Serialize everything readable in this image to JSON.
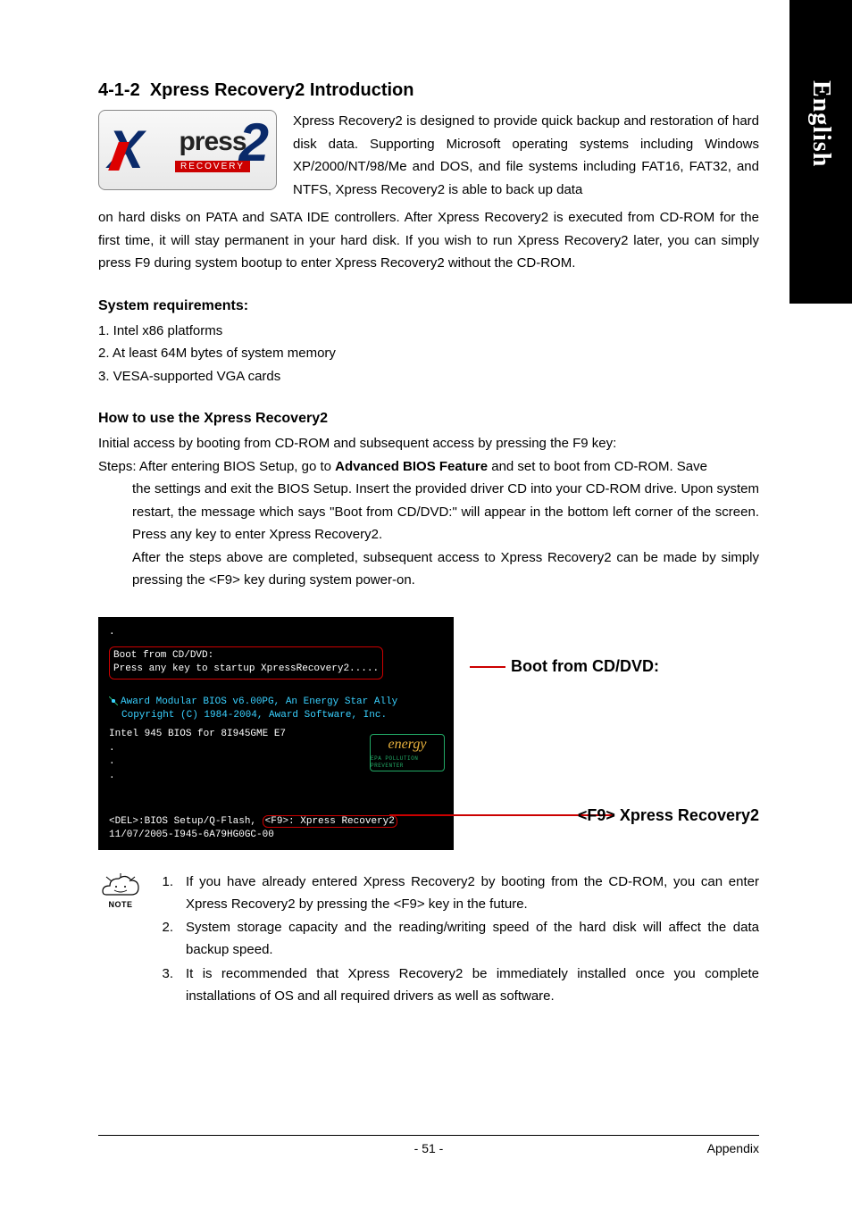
{
  "sidebar": {
    "language": "English"
  },
  "heading": {
    "number": "4-1-2",
    "title": "Xpress Recovery2 Introduction"
  },
  "logo": {
    "press": "press",
    "recovery": "RECOVERY"
  },
  "intro": {
    "right_text": "Xpress Recovery2 is designed to provide quick backup and restoration of hard disk data. Supporting Microsoft operating systems including Windows XP/2000/NT/98/Me and DOS, and file systems including FAT16, FAT32, and NTFS, Xpress Recovery2 is able to back up data",
    "continued": "on hard disks on PATA and SATA IDE controllers.  After Xpress Recovery2 is executed from CD-ROM for the first time, it will stay permanent in your hard disk. If you wish to run Xpress Recovery2 later, you can simply press F9 during system bootup to enter Xpress Recovery2 without the CD-ROM."
  },
  "system_requirements": {
    "heading": "System requirements:",
    "items": [
      "1. Intel x86 platforms",
      "2. At least 64M bytes of system memory",
      "3. VESA-supported VGA cards"
    ]
  },
  "howto": {
    "heading": "How to use the Xpress Recovery2",
    "line1": "Initial access by booting from CD-ROM and subsequent access by pressing the F9 key:",
    "steps_prefix": "Steps: After entering BIOS Setup, go to ",
    "steps_bold": "Advanced BIOS Feature",
    "steps_suffix": " and set to boot from CD-ROM. Save",
    "body": "the settings and exit the BIOS Setup. Insert the provided driver CD into your CD-ROM drive. Upon system restart, the message which says \"Boot from CD/DVD:\" will appear in the bottom left corner of the screen.  Press any key to enter Xpress Recovery2.",
    "body2": "After the steps above are completed, subsequent access to Xpress Recovery2 can be made by simply pressing the <F9> key during system power-on."
  },
  "bios": {
    "boot_line": "Boot from CD/DVD:",
    "press_line": "Press any key to startup XpressRecovery2.....",
    "award1": "Award Modular BIOS v6.00PG, An Energy Star Ally",
    "award2": "Copyright  (C) 1984-2004, Award Software,  Inc.",
    "intel_line": "Intel 945 BIOS for 8I945GME E7",
    "energy_script": "energy",
    "energy_epa": "EPA  POLLUTION PREVENTER",
    "bottom_del": "<DEL>:BIOS Setup/Q-Flash,",
    "bottom_f9": "<F9>: Xpress Recovery2",
    "bottom_id": "11/07/2005-I945-6A79HG0GC-00"
  },
  "callouts": {
    "boot": "Boot from CD/DVD:",
    "f9": "<F9> Xpress Recovery2"
  },
  "notes": {
    "label": "NOTE",
    "items": [
      {
        "num": "1.",
        "text": "If you have already entered Xpress Recovery2 by booting from the CD-ROM, you can enter Xpress Recovery2 by pressing the <F9> key in the future."
      },
      {
        "num": "2.",
        "text": "System storage capacity and the reading/writing speed of the hard disk will affect the data backup speed."
      },
      {
        "num": "3.",
        "text": "It is recommended that Xpress Recovery2 be immediately installed once you complete installations of OS and all required drivers as well as software."
      }
    ]
  },
  "footer": {
    "page": "- 51 -",
    "section": "Appendix"
  }
}
